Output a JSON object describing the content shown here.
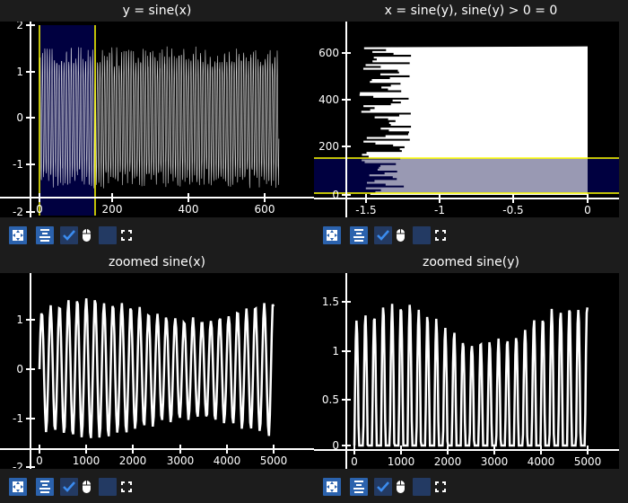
{
  "plots": [
    {
      "title": "y = sine(x)",
      "xticks": [
        "0",
        "200",
        "400",
        "600"
      ],
      "yticks": [
        "2",
        "1",
        "0",
        "-1",
        "-2"
      ]
    },
    {
      "title": "x = sine(y), sine(y) > 0 = 0",
      "xticks": [
        "-1.5",
        "-1",
        "-0.5",
        "0"
      ],
      "yticks": [
        "600",
        "400",
        "200",
        "0"
      ]
    },
    {
      "title": "zoomed sine(x)",
      "xticks": [
        "0",
        "1000",
        "2000",
        "3000",
        "4000",
        "5000"
      ],
      "yticks": [
        "1",
        "0",
        "-1",
        "-2"
      ]
    },
    {
      "title": "zoomed sine(y)",
      "xticks": [
        "0",
        "1000",
        "2000",
        "3000",
        "4000",
        "5000"
      ],
      "yticks": [
        "1.5",
        "1",
        "0.5",
        "0"
      ]
    }
  ],
  "toolbar": {
    "icons": [
      "fit-icon",
      "align-icon",
      "checkbox-checked",
      "mouse-icon",
      "checkbox-unchecked",
      "fullscreen-icon"
    ],
    "checked": true
  },
  "colors": {
    "accent": "#2b62ad",
    "selection": "#000040",
    "selection_border": "#ffff00",
    "series": "#ffffff"
  },
  "chart_data": [
    {
      "type": "line",
      "title": "y = sine(x)",
      "xlim": [
        -25,
        700
      ],
      "ylim": [
        -2,
        2
      ],
      "selection_x": [
        0,
        150
      ]
    },
    {
      "type": "area",
      "title": "x = sine(y), sine(y) > 0 = 0",
      "xlim": [
        -1.7,
        0.2
      ],
      "ylim": [
        -10,
        720
      ],
      "selection_y": [
        0,
        150
      ]
    },
    {
      "type": "line",
      "title": "zoomed sine(x)",
      "xlim": [
        -200,
        5300
      ],
      "ylim": [
        -2,
        1.6
      ]
    },
    {
      "type": "line",
      "title": "zoomed sine(y)",
      "xlim": [
        -200,
        5700
      ],
      "ylim": [
        -0.05,
        1.75
      ]
    }
  ]
}
